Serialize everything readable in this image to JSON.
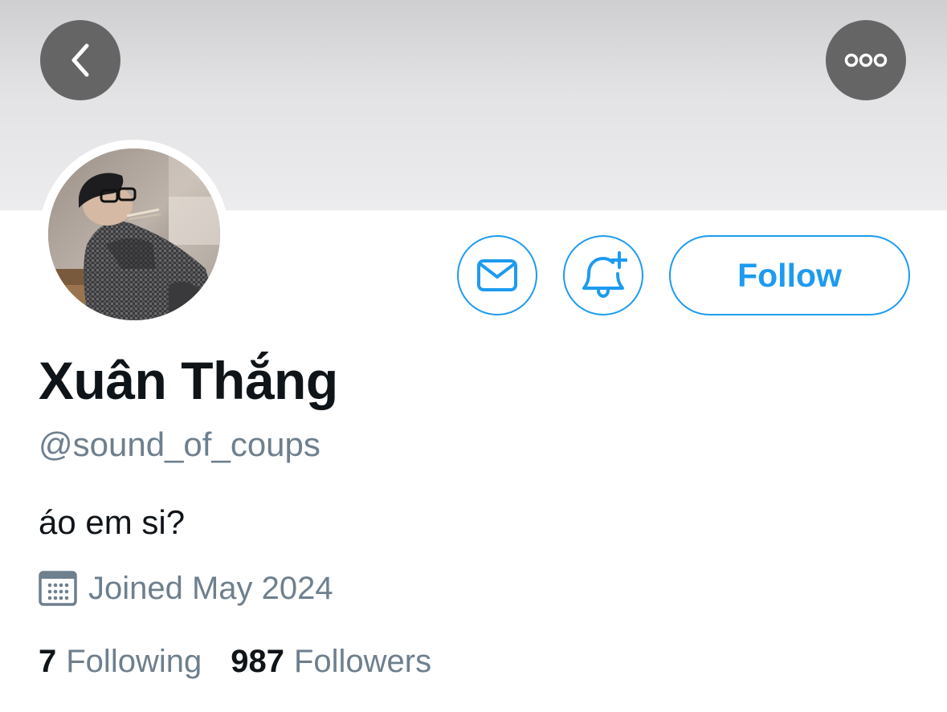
{
  "profile": {
    "display_name": "Xuân Thắng",
    "handle": "@sound_of_coups",
    "bio": "áo em si?",
    "joined": "Joined May 2024"
  },
  "stats": {
    "following_count": "7",
    "following_label": "Following",
    "followers_count": "987",
    "followers_label": "Followers"
  },
  "actions": {
    "follow_label": "Follow"
  },
  "icons": {
    "back": "chevron-left-icon",
    "more": "more-horizontal-icon",
    "message": "envelope-icon",
    "notify": "bell-plus-icon",
    "calendar": "calendar-icon"
  },
  "colors": {
    "accent": "#1d9bf0",
    "text_primary": "#0f1419",
    "text_secondary": "#6e7f8d",
    "overlay_button": "#656566"
  }
}
